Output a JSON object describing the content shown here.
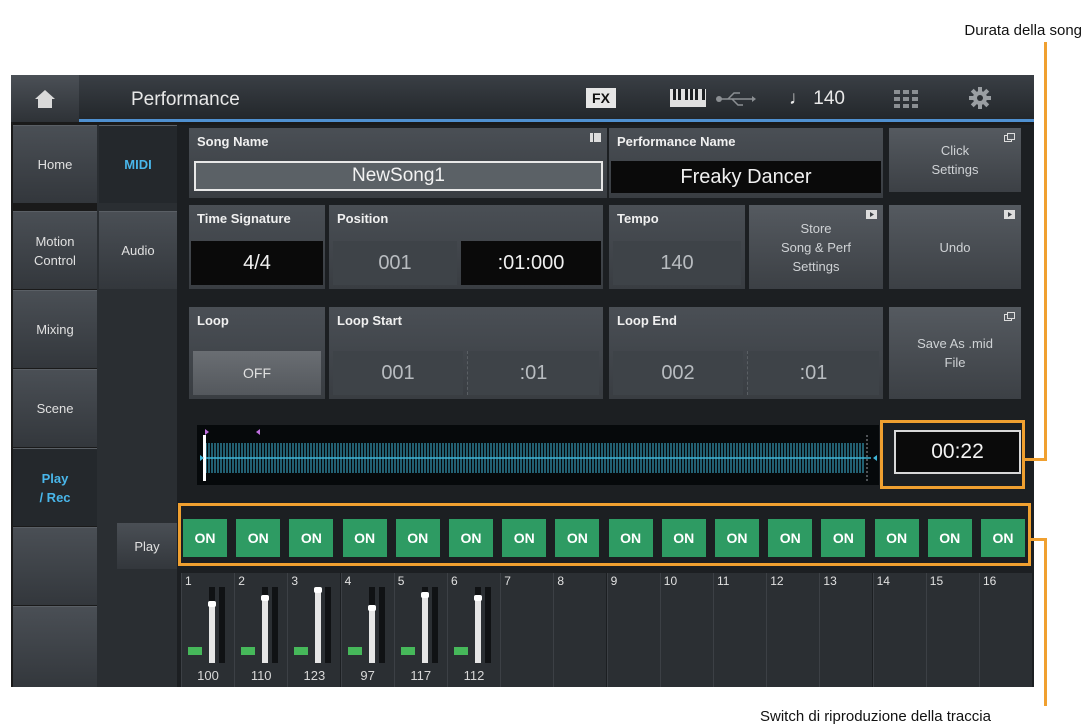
{
  "callouts": {
    "song_length": "Durata della song",
    "track_play": "Switch di riproduzione della traccia"
  },
  "topbar": {
    "title": "Performance",
    "fx": "FX",
    "tempo": "♩ 140",
    "icons": [
      "home-icon",
      "keyboard-icon",
      "usb-icon",
      "quarter-note-icon",
      "grid-icon",
      "gear-icon"
    ]
  },
  "sidebar": {
    "items": [
      {
        "label": "Home"
      },
      {
        "label": "Motion\nControl"
      },
      {
        "label": "Mixing"
      },
      {
        "label": "Scene"
      },
      {
        "label": "Play\n/ Rec"
      }
    ]
  },
  "subtabs": {
    "midi": "MIDI",
    "audio": "Audio"
  },
  "song": {
    "song_name_label": "Song Name",
    "song_name": "NewSong1",
    "performance_name_label": "Performance Name",
    "performance_name": "Freaky Dancer",
    "click_settings": "Click\nSettings",
    "time_signature_label": "Time Signature",
    "time_signature": "4/4",
    "position_label": "Position",
    "position_measure": "001",
    "position_beat": ":01:000",
    "tempo_label": "Tempo",
    "tempo": "140",
    "store_settings": "Store\nSong & Perf\nSettings",
    "undo": "Undo",
    "loop_label": "Loop",
    "loop": "OFF",
    "loop_start_label": "Loop Start",
    "loop_start_measure": "001",
    "loop_start_beat": ":01",
    "loop_end_label": "Loop End",
    "loop_end_measure": "002",
    "loop_end_beat": ":01",
    "save_as_mid": "Save As .mid\nFile",
    "song_length": "00:22"
  },
  "play_row": {
    "label": "Play",
    "switches": [
      "ON",
      "ON",
      "ON",
      "ON",
      "ON",
      "ON",
      "ON",
      "ON",
      "ON",
      "ON",
      "ON",
      "ON",
      "ON",
      "ON",
      "ON",
      "ON"
    ]
  },
  "tracks": [
    {
      "num": "1",
      "volume": "100"
    },
    {
      "num": "2",
      "volume": "110"
    },
    {
      "num": "3",
      "volume": "123"
    },
    {
      "num": "4",
      "volume": "97"
    },
    {
      "num": "5",
      "volume": "117"
    },
    {
      "num": "6",
      "volume": "112"
    },
    {
      "num": "7",
      "volume": ""
    },
    {
      "num": "8",
      "volume": ""
    },
    {
      "num": "9",
      "volume": ""
    },
    {
      "num": "10",
      "volume": ""
    },
    {
      "num": "11",
      "volume": ""
    },
    {
      "num": "12",
      "volume": ""
    },
    {
      "num": "13",
      "volume": ""
    },
    {
      "num": "14",
      "volume": ""
    },
    {
      "num": "15",
      "volume": ""
    },
    {
      "num": "16",
      "volume": ""
    }
  ],
  "colors": {
    "accent": "#49b6ea",
    "switch_on": "#2e9b63",
    "callout": "#f0a030",
    "topbar_line": "#4f90d0"
  }
}
